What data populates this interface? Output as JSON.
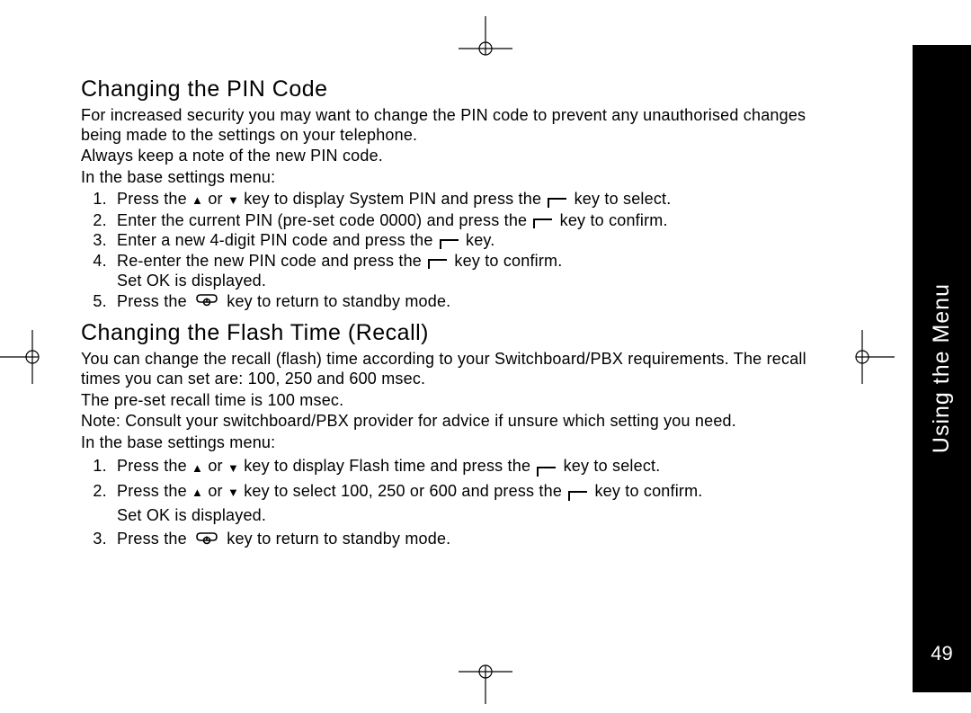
{
  "sidebar": {
    "title": "Using the Menu",
    "page": "49"
  },
  "section1": {
    "heading": "Changing the PIN Code",
    "p1": "For increased security you may want to change the PIN code to prevent any unauthorised changes being made to the settings on your telephone.",
    "p2": "Always keep a note of the new PIN code.",
    "p3": "In the base settings menu:",
    "li1a": "Press the ",
    "li1b": " or ",
    "li1c": " key to display System PIN and press the ",
    "li1d": " key to select.",
    "li2a": "Enter the current PIN (pre-set code 0000) and press the ",
    "li2b": " key to confirm.",
    "li3a": "Enter a new 4-digit PIN code and press the ",
    "li3b": " key.",
    "li4a": "Re-enter the new PIN code and press the ",
    "li4b": " key to confirm.",
    "li4c": "Set OK is displayed.",
    "li5a": "Press the ",
    "li5b": " key to return to standby mode."
  },
  "section2": {
    "heading": "Changing the Flash Time (Recall)",
    "p1": "You can change the recall (flash) time according to your Switchboard/PBX requirements. The recall times you can set are: 100, 250 and 600 msec.",
    "p2": "The pre-set recall time is 100 msec.",
    "p3": "Note: Consult your switchboard/PBX provider for advice if unsure which setting you need.",
    "p4": "In the base settings menu:",
    "li1a": "Press the ",
    "li1b": " or ",
    "li1c": " key to display Flash time and press the ",
    "li1d": " key to select.",
    "li2a": "Press the ",
    "li2b": " or ",
    "li2c": " key to select 100, 250 or 600 and press the ",
    "li2d": " key to confirm.",
    "li2e": "Set OK is displayed.",
    "li3a": "Press the ",
    "li3b": " key to return to standby mode."
  }
}
